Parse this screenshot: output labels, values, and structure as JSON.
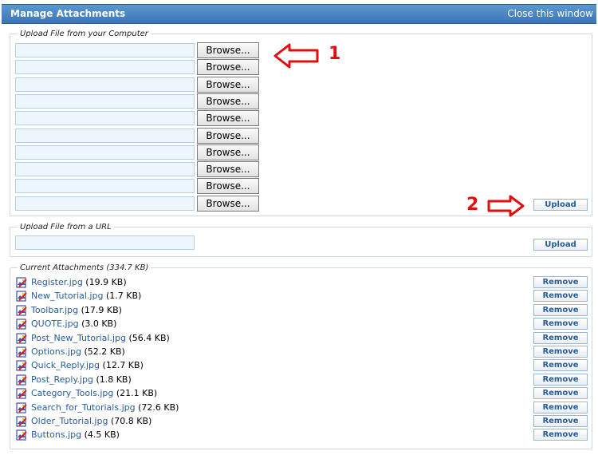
{
  "window": {
    "title": "Manage Attachments",
    "close_label": "Close this window"
  },
  "upload_computer": {
    "legend": "Upload File from your Computer",
    "browse_label": "Browse...",
    "upload_label": "Upload",
    "field_count": 10
  },
  "upload_url": {
    "legend": "Upload File from a URL",
    "url_value": "",
    "upload_label": "Upload"
  },
  "annotations": {
    "one": "1",
    "two": "2",
    "arrow_color": "#e01010"
  },
  "current_attachments": {
    "legend": "Current Attachments (334.7 KB)",
    "remove_label": "Remove",
    "items": [
      {
        "name": "Register.jpg",
        "size": "(19.9 KB)"
      },
      {
        "name": "New_Tutorial.jpg",
        "size": "(1.7 KB)"
      },
      {
        "name": "Toolbar.jpg",
        "size": "(17.9 KB)"
      },
      {
        "name": "QUOTE.jpg",
        "size": "(3.0 KB)"
      },
      {
        "name": "Post_New_Tutorial.jpg",
        "size": "(56.4 KB)"
      },
      {
        "name": "Options.jpg",
        "size": "(52.2 KB)"
      },
      {
        "name": "Quick_Reply.jpg",
        "size": "(12.7 KB)"
      },
      {
        "name": "Post_Reply.jpg",
        "size": "(1.8 KB)"
      },
      {
        "name": "Category_Tools.jpg",
        "size": "(21.1 KB)"
      },
      {
        "name": "Search_for_Tutorials.jpg",
        "size": "(72.6 KB)"
      },
      {
        "name": "Older_Tutorial.jpg",
        "size": "(70.8 KB)"
      },
      {
        "name": "Buttons.jpg",
        "size": "(4.5 KB)"
      }
    ]
  },
  "colors": {
    "title_bar": "#3a76b6",
    "link": "#2a5c98",
    "input_bg": "#eef6fd",
    "annotation": "#e01010"
  }
}
